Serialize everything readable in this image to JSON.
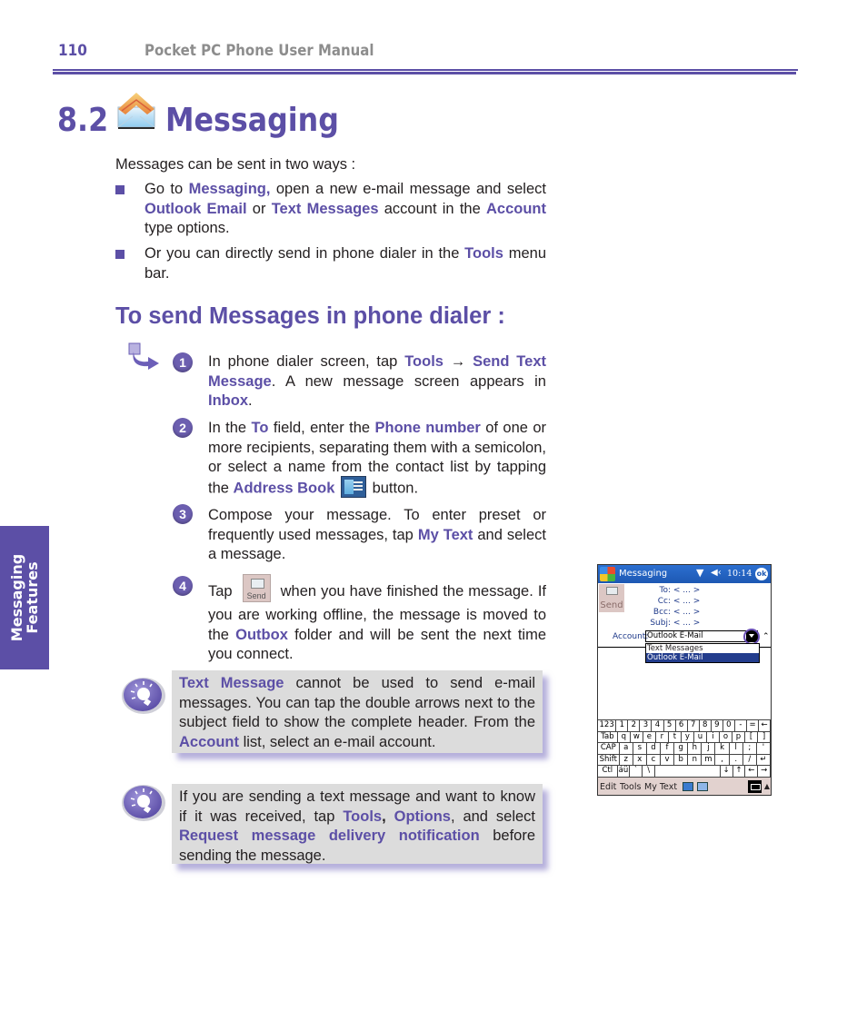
{
  "header": {
    "page_number": "110",
    "manual_title": "Pocket PC Phone User Manual"
  },
  "title": {
    "number": "8.2",
    "icon": "messaging-envelope-icon",
    "text": "Messaging"
  },
  "intro": "Messages can be sent in two ways :",
  "bullets": [
    {
      "parts": [
        "Go to ",
        "Messaging,",
        " open a new e-mail message and select  ",
        "Outlook Email",
        " or ",
        "Text Messages",
        " account in the ",
        "Account",
        " type options."
      ]
    },
    {
      "parts": [
        "Or you can directly send in phone dialer in the ",
        "Tools",
        " menu bar."
      ]
    }
  ],
  "section_heading": "To send Messages in phone dialer :",
  "section_icon": "arrow-procedure-icon",
  "steps": [
    {
      "number": "1",
      "parts": [
        "In phone dialer screen, tap ",
        "Tools",
        " → ",
        "Send Text Message",
        ". A new message screen appears in ",
        "Inbox",
        "."
      ]
    },
    {
      "number": "2",
      "parts": [
        "In the ",
        "To",
        " field, enter the ",
        "Phone number",
        " of one or more recipients, separating them with a semicolon, or select a name from the contact list by tapping the ",
        "Address Book",
        " button."
      ],
      "icon": "address-book-icon"
    },
    {
      "number": "3",
      "parts": [
        "Compose your message. To enter preset or frequently  used messages, tap ",
        "My Text",
        " and select a message."
      ]
    },
    {
      "number": "4",
      "parts": [
        "Tap ",
        " when you have finished the message. If you are working offline, the message is moved to the ",
        "Outbox",
        " folder and will be sent the next time you connect."
      ],
      "icon": "send-button-icon",
      "icon_label": "Send"
    }
  ],
  "notes": [
    {
      "icon": "lightbulb-tip-icon",
      "parts": [
        "Text Message",
        " cannot be used to send e-mail messages.  You can tap the double arrows next to the subject field to show the complete header. From the ",
        "Account",
        " list, select an e-mail account."
      ]
    },
    {
      "icon": "lightbulb-tip-icon",
      "parts": [
        "If you are sending a text message and want to know if it was received, tap ",
        "Tools",
        ", ",
        "Options",
        ", and select ",
        "Request message delivery notification",
        " before sending the message."
      ]
    }
  ],
  "side_tab": {
    "line1": "Messaging",
    "line2": "Features"
  },
  "device": {
    "app_title": "Messaging",
    "time": "10:14",
    "ok_label": "ok",
    "send_label": "Send",
    "fields": [
      {
        "label": "To:",
        "value": "< ... >"
      },
      {
        "label": "Cc:",
        "value": "< ... >"
      },
      {
        "label": "Bcc:",
        "value": "< ... >"
      },
      {
        "label": "Subj:",
        "value": "< ... >"
      }
    ],
    "account_label": "Account:",
    "account_value": "Outlook E-Mail",
    "account_options": [
      "Text Messages",
      "Outlook E-Mail"
    ],
    "account_selected": "Outlook E-Mail",
    "keyboard_rows": [
      [
        "123",
        "1",
        "2",
        "3",
        "4",
        "5",
        "6",
        "7",
        "8",
        "9",
        "0",
        "-",
        "=",
        "←"
      ],
      [
        "Tab",
        "q",
        "w",
        "e",
        "r",
        "t",
        "y",
        "u",
        "i",
        "o",
        "p",
        "[",
        "]"
      ],
      [
        "CAP",
        "a",
        "s",
        "d",
        "f",
        "g",
        "h",
        "j",
        "k",
        "l",
        ";",
        "'"
      ],
      [
        "Shift",
        "z",
        "x",
        "c",
        "v",
        "b",
        "n",
        "m",
        ",",
        ".",
        "/",
        "↵"
      ],
      [
        "Ctl",
        "áü",
        "`",
        "\\",
        "",
        "↓",
        "↑",
        "←",
        "→"
      ]
    ],
    "menu": {
      "edit": "Edit",
      "tools": "Tools",
      "my_text": "My Text"
    }
  },
  "colors": {
    "accent": "#5c4fa6",
    "header_gray": "#8d8d8d",
    "note_bg": "#dcdcdc",
    "device_titlebar": "#1d58b3",
    "device_selection": "#233d8d"
  }
}
